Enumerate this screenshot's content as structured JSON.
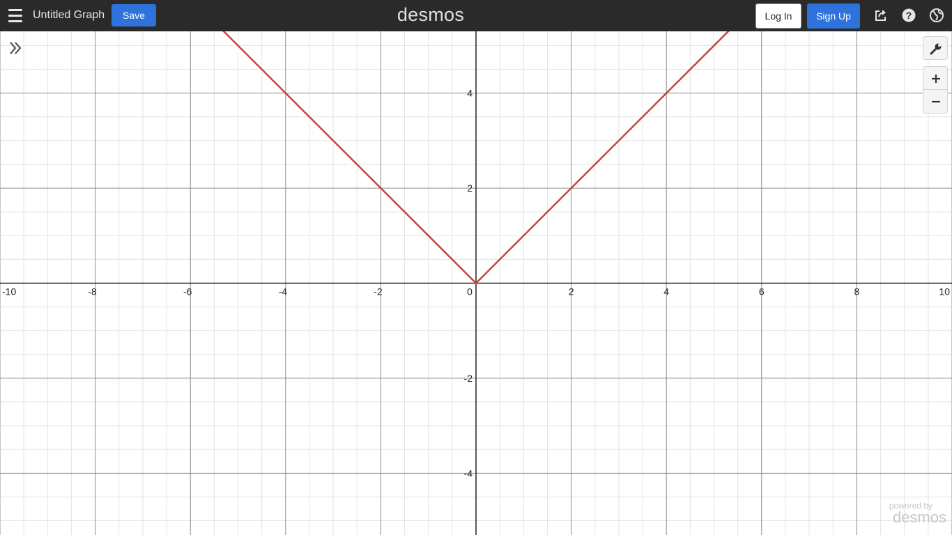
{
  "header": {
    "graph_title": "Untitled Graph",
    "save_label": "Save",
    "logo_text": "desmos",
    "login_label": "Log In",
    "signup_label": "Sign Up"
  },
  "watermark": {
    "line1": "powered by",
    "line2": "desmos"
  },
  "colors": {
    "topbar": "#2a2a2a",
    "accent_blue": "#2f72dc",
    "curve": "#c74440"
  },
  "chart_data": {
    "type": "line",
    "xlim": [
      -10,
      10
    ],
    "ylim": [
      -5.3,
      5.3
    ],
    "grid": true,
    "x_ticks": [
      -10,
      -8,
      -6,
      -4,
      -2,
      0,
      2,
      4,
      6,
      8,
      10
    ],
    "y_ticks": [
      -4,
      -2,
      2,
      4
    ],
    "series": [
      {
        "x": [
          -10,
          0,
          10
        ],
        "y": [
          10,
          0,
          10
        ]
      }
    ]
  }
}
